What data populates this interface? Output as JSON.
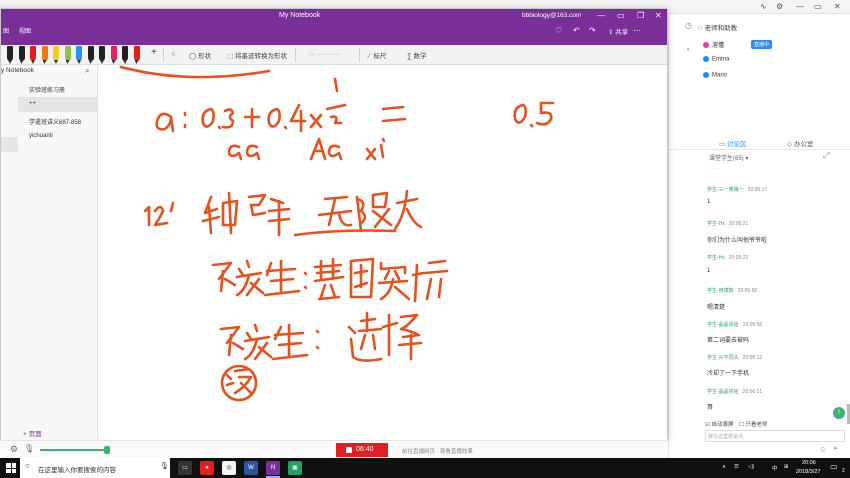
{
  "background_app": {
    "right_icons": [
      "waveform-icon",
      "gear-icon",
      "minimize-icon",
      "maximize-icon",
      "close-icon"
    ]
  },
  "onenote": {
    "title": "My Notebook",
    "account": "bbbiology@163.com",
    "ribbon_tabs": [
      "图",
      "视图"
    ],
    "share_label": "共享",
    "toolbar": {
      "shape_label": "形状",
      "convert_label": "将墨迹转换为形状",
      "ruler_label": "标尺",
      "math_label": "数学"
    },
    "pen_colors": [
      "#222222",
      "#222222",
      "#e02020",
      "#f07a10",
      "#f0d020",
      "#8bc34a",
      "#2196f3",
      "#222222",
      "#222222",
      "#e91e63",
      "#222222",
      "#e02020"
    ],
    "sidebar": {
      "notebook_name": "y Notebook",
      "pages": [
        "实验班练习册",
        "++",
        "学遣班讲义687-858",
        "yichuanti"
      ],
      "add_page_label": "页面"
    },
    "canvas": {
      "handwriting_lines": [
        "a: 0.3 + 0.4 × 1/2 = 0.5",
        "aa  Aa ×1/2",
        "12' 种群  无限大",
        "不发生: 基因突变",
        "不发生: 选择",
        "没"
      ]
    }
  },
  "right_panel": {
    "header": "老师和助教",
    "teachers": [
      {
        "name": "溶懂",
        "badge": "直播中"
      },
      {
        "name": "Emma"
      },
      {
        "name": "Mario"
      }
    ],
    "tabs": [
      "讨论区",
      "办公室"
    ],
    "filter_label": "课堂学生(65)",
    "messages": [
      {
        "user": "学生-三一黄梅一",
        "time": "20:05:17",
        "text": "1"
      },
      {
        "user": "学生-Hx",
        "time": "20:05:21",
        "text": "你们为什么叫他爷爷啦"
      },
      {
        "user": "学生-Hx",
        "time": "20:05:22",
        "text": "1"
      },
      {
        "user": "学生-晓博数",
        "time": "20:05:50",
        "text": "嗯清楚"
      },
      {
        "user": "学生-晶晶买给",
        "time": "20:05:56",
        "text": "第二词要去被吗"
      },
      {
        "user": "学生-从不同头",
        "time": "20:06:12",
        "text": "冷却了一下手机"
      },
      {
        "user": "学生-晶晶买给",
        "time": "20:06:21",
        "text": "哥"
      }
    ],
    "auto_scroll_label": "自动滚屏",
    "only_teacher_label": "只看老师",
    "input_placeholder": "我在这里想说点",
    "fab_label": "!"
  },
  "bottom_bar": {
    "timer": "06:40",
    "live_note": "前往直播网页 · 观看直播效果"
  },
  "taskbar": {
    "search_placeholder": "在这里输入你要搜索的内容",
    "time": "20:06",
    "date": "2018/3/27",
    "lang": "中",
    "notification_count": "2"
  }
}
